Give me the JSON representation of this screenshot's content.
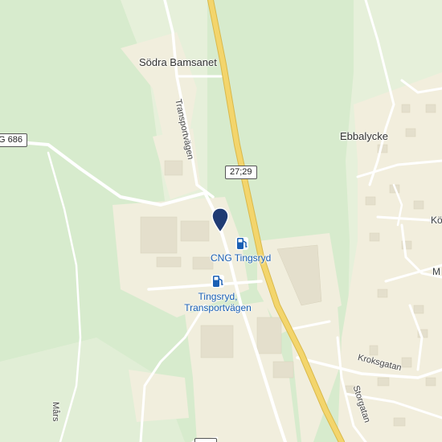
{
  "map": {
    "colors": {
      "forest": "#d7ebcd",
      "open_land": "#e6f0da",
      "builtup": "#f1eedd",
      "highway": "#f3d56c",
      "road": "#ffffff",
      "poi_blue": "#1a5fb4",
      "pin_navy": "#1f3b73"
    },
    "labels": {
      "sodra_bamsanet": "Södra Bamsanet",
      "ebbalycke": "Ebbalycke",
      "transportvagen": "Transportvägen",
      "kroksgatan": "Kroksgatan",
      "storgatan": "Storgatan",
      "kot_partial": "Köt",
      "m_partial": "M",
      "mars_partial": "Mårs"
    },
    "shields": {
      "route_686": "G 686",
      "route_27_29": "27;29"
    },
    "pois": [
      {
        "id": "cng",
        "name": "CNG Tingsryd",
        "icon": "fuel-pump-icon"
      },
      {
        "id": "station",
        "name_line1": "Tingsryd,",
        "name_line2": "Transportvägen",
        "icon": "fuel-pump-icon"
      }
    ],
    "marker": {
      "icon": "location-pin-icon"
    }
  }
}
